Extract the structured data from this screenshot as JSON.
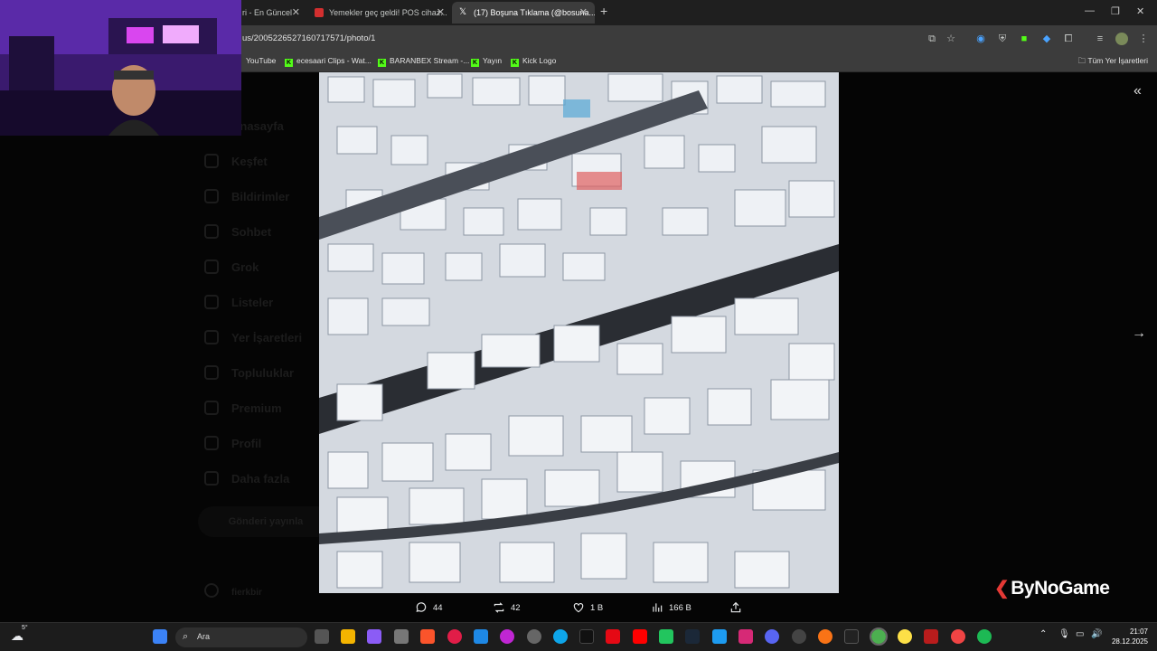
{
  "browser": {
    "tabs": [
      {
        "title": "ri - En Güncel",
        "active": false,
        "favicon_color": "#1f1f1f"
      },
      {
        "title": "Yemekler geç geldi! POS cihaz...",
        "active": false,
        "favicon_color": "#d32f2f"
      },
      {
        "title": "(17) Boşuna Tıklama (@bosuna...",
        "active": true,
        "favicon_color": "#000000"
      }
    ],
    "new_tab": "+",
    "url": "us/2005226527160717571/photo/1",
    "bookmarks": [
      {
        "label": "YouTube",
        "icon": "youtube-icon"
      },
      {
        "label": "ecesaari Clips - Wat...",
        "icon": "kick-icon"
      },
      {
        "label": "BARANBEX Stream -...",
        "icon": "kick-icon"
      },
      {
        "label": "Yayın",
        "icon": "kick-icon"
      },
      {
        "label": "Kick Logo",
        "icon": "kick-icon"
      }
    ],
    "all_bookmarks": "Tüm Yer İşaretleri"
  },
  "background_nav": [
    "Anasayfa",
    "Keşfet",
    "Bildirimler",
    "Sohbet",
    "Grok",
    "Listeler",
    "Yer İşaretleri",
    "Topluluklar",
    "Premium",
    "Profil",
    "Daha fazla"
  ],
  "background_post_button": "Gönderi yayınla",
  "background_user": "fierkbir",
  "tweet_actions": {
    "replies": "44",
    "reposts": "42",
    "likes": "1 B",
    "views": "166 B"
  },
  "watermark": "ByNoGame",
  "taskbar": {
    "weather": "5°",
    "search_placeholder": "Ara",
    "time": "21:07",
    "date": "28.12.2025"
  },
  "colors": {
    "kick_green": "#53fc18",
    "tab_bar": "#1f1f1f",
    "toolbar": "#3c3c3c"
  }
}
